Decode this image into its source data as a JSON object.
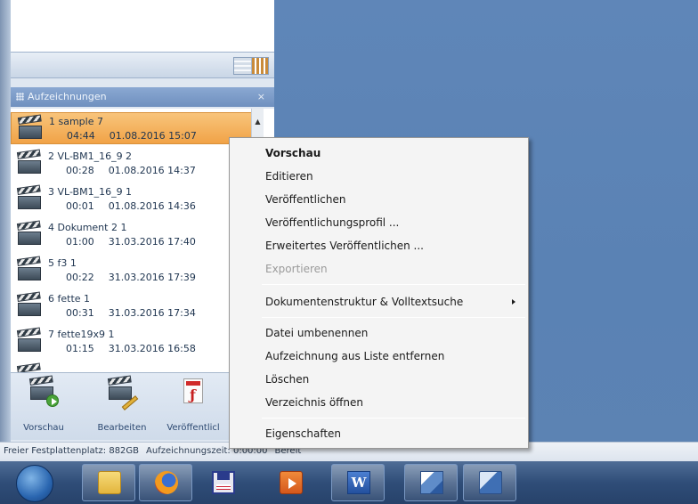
{
  "panel": {
    "title": "Aufzeichnungen",
    "close": "×"
  },
  "recordings": [
    {
      "name": "1  sample 7",
      "duration": "04:44",
      "date": "01.08.2016 15:07",
      "selected": true
    },
    {
      "name": "2  VL-BM1_16_9 2",
      "duration": "00:28",
      "date": "01.08.2016 14:37",
      "selected": false
    },
    {
      "name": "3  VL-BM1_16_9 1",
      "duration": "00:01",
      "date": "01.08.2016 14:36",
      "selected": false
    },
    {
      "name": "4  Dokument 2 1",
      "duration": "01:00",
      "date": "31.03.2016 17:40",
      "selected": false
    },
    {
      "name": "5  f3 1",
      "duration": "00:22",
      "date": "31.03.2016 17:39",
      "selected": false
    },
    {
      "name": "6  fette 1",
      "duration": "00:31",
      "date": "31.03.2016 17:34",
      "selected": false
    },
    {
      "name": "7  fette19x9 1",
      "duration": "01:15",
      "date": "31.03.2016 16:58",
      "selected": false
    }
  ],
  "toolbar": {
    "preview": "Vorschau",
    "edit": "Bearbeiten",
    "publish": "Veröffentlicl"
  },
  "statusbar": {
    "free_space": "Freier Festplattenplatz: 882GB",
    "rec_time": "Aufzeichnungszeit: 0:00:00",
    "state": "Bereit"
  },
  "context_menu": {
    "items": [
      {
        "label": "Vorschau",
        "bold": true,
        "disabled": false
      },
      {
        "label": "Editieren",
        "bold": false,
        "disabled": false
      },
      {
        "label": "Veröffentlichen",
        "bold": false,
        "disabled": false
      },
      {
        "label": "Veröffentlichungsprofil ...",
        "bold": false,
        "disabled": false
      },
      {
        "label": "Erweitertes Veröffentlichen ...",
        "bold": false,
        "disabled": false
      },
      {
        "label": "Exportieren",
        "bold": false,
        "disabled": true
      },
      {
        "label": "Dokumentenstruktur & Volltextsuche",
        "bold": false,
        "disabled": false,
        "submenu": true
      },
      {
        "label": "Datei umbenennen",
        "bold": false,
        "disabled": false
      },
      {
        "label": "Aufzeichnung aus Liste entfernen",
        "bold": false,
        "disabled": false
      },
      {
        "label": "Löschen",
        "bold": false,
        "disabled": false
      },
      {
        "label": "Verzeichnis öffnen",
        "bold": false,
        "disabled": false
      },
      {
        "label": "Eigenschaften",
        "bold": false,
        "disabled": false
      }
    ]
  },
  "taskbar": {
    "buttons": [
      "start-orb-icon",
      "folder-icon",
      "firefox-icon",
      "save-disk-icon",
      "media-record-icon",
      "word-icon",
      "vl-app-icon",
      "vl-editor-icon"
    ],
    "word_glyph": "W"
  }
}
